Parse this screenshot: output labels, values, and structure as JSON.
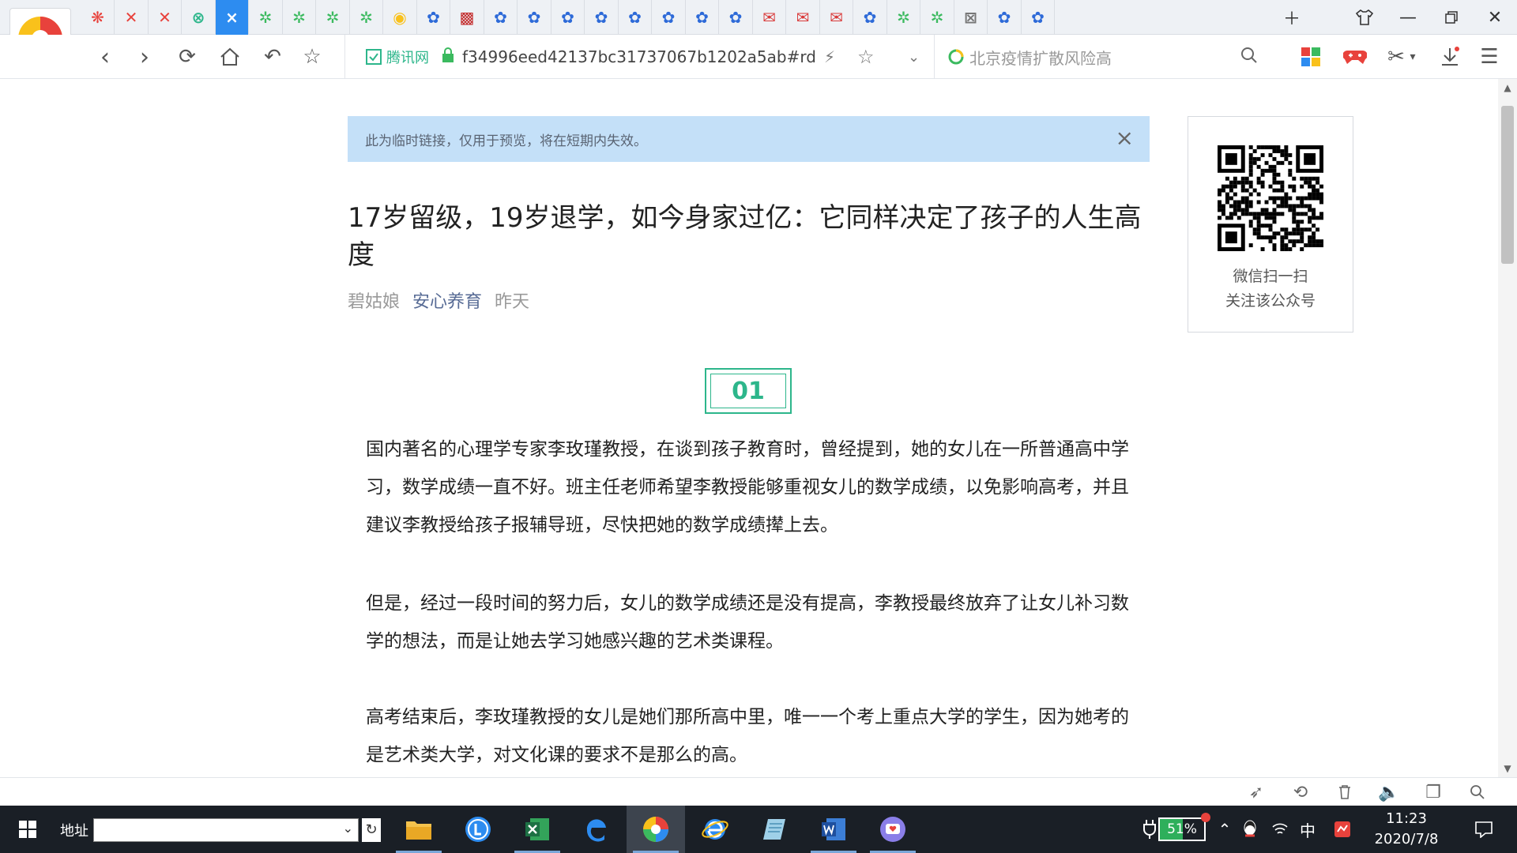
{
  "tabs": [
    {
      "icon": "tab-app-icon-red"
    },
    {
      "icon": "tab-x-icon"
    },
    {
      "icon": "tab-x-icon"
    },
    {
      "icon": "tab-green-icon"
    },
    {
      "icon": "tab-close-icon",
      "label": "×",
      "active": true
    },
    {
      "icon": "tab-network-icon"
    },
    {
      "icon": "tab-network-icon"
    },
    {
      "icon": "tab-network-icon"
    },
    {
      "icon": "tab-network-icon"
    },
    {
      "icon": "tab-chrome-icon"
    },
    {
      "icon": "tab-baidu-icon"
    },
    {
      "icon": "tab-dark-icon"
    },
    {
      "icon": "tab-baidu-icon"
    },
    {
      "icon": "tab-baidu-icon"
    },
    {
      "icon": "tab-baidu-icon"
    },
    {
      "icon": "tab-baidu-icon"
    },
    {
      "icon": "tab-baidu-icon"
    },
    {
      "icon": "tab-baidu-icon"
    },
    {
      "icon": "tab-baidu-icon"
    },
    {
      "icon": "tab-baidu-icon"
    },
    {
      "icon": "tab-mail-icon"
    },
    {
      "icon": "tab-mail-icon"
    },
    {
      "icon": "tab-mail-icon"
    },
    {
      "icon": "tab-baidu-icon"
    },
    {
      "icon": "tab-network-icon"
    },
    {
      "icon": "tab-network-icon"
    },
    {
      "icon": "tab-grid-icon"
    },
    {
      "icon": "tab-baidu-icon"
    },
    {
      "icon": "tab-baidu-icon"
    }
  ],
  "address": {
    "site_badge": "腾讯网",
    "url": "f34996eed42137bc31737067b1202a5ab#rd"
  },
  "search": {
    "placeholder": "北京疫情扩散风险高"
  },
  "banner": {
    "text": "此为临时链接，仅用于预览，将在短期内失效。",
    "close": "×"
  },
  "article": {
    "title": "17岁留级，19岁退学，如今身家过亿：它同样决定了孩子的人生高度",
    "author": "碧姑娘",
    "account": "安心养育",
    "time": "昨天",
    "section_number": "01",
    "paragraphs": [
      "国内著名的心理学专家李玫瑾教授，在谈到孩子教育时，曾经提到，她的女儿在一所普通高中学习，数学成绩一直不好。班主任老师希望李教授能够重视女儿的数学成绩，以免影响高考，并且建议李教授给孩子报辅导班，尽快把她的数学成绩撵上去。",
      "但是，经过一段时间的努力后，女儿的数学成绩还是没有提高，李教授最终放弃了让女儿补习数学的想法，而是让她去学习她感兴趣的艺术类课程。",
      "高考结束后，李玫瑾教授的女儿是她们那所高中里，唯一一个考上重点大学的学生，因为她考的是艺术类大学，对文化课的要求不是那么的高。"
    ]
  },
  "qr": {
    "line1": "微信扫一扫",
    "line2": "关注该公众号"
  },
  "taskbar": {
    "address_label": "地址",
    "battery": "51%",
    "ime": "中",
    "time": "11:23",
    "date": "2020/7/8"
  },
  "colors": {
    "accent": "#2d8cf0",
    "section_green": "#2db68b",
    "banner_bg": "#c4e0f8",
    "taskbar_bg": "#1a1f26"
  }
}
